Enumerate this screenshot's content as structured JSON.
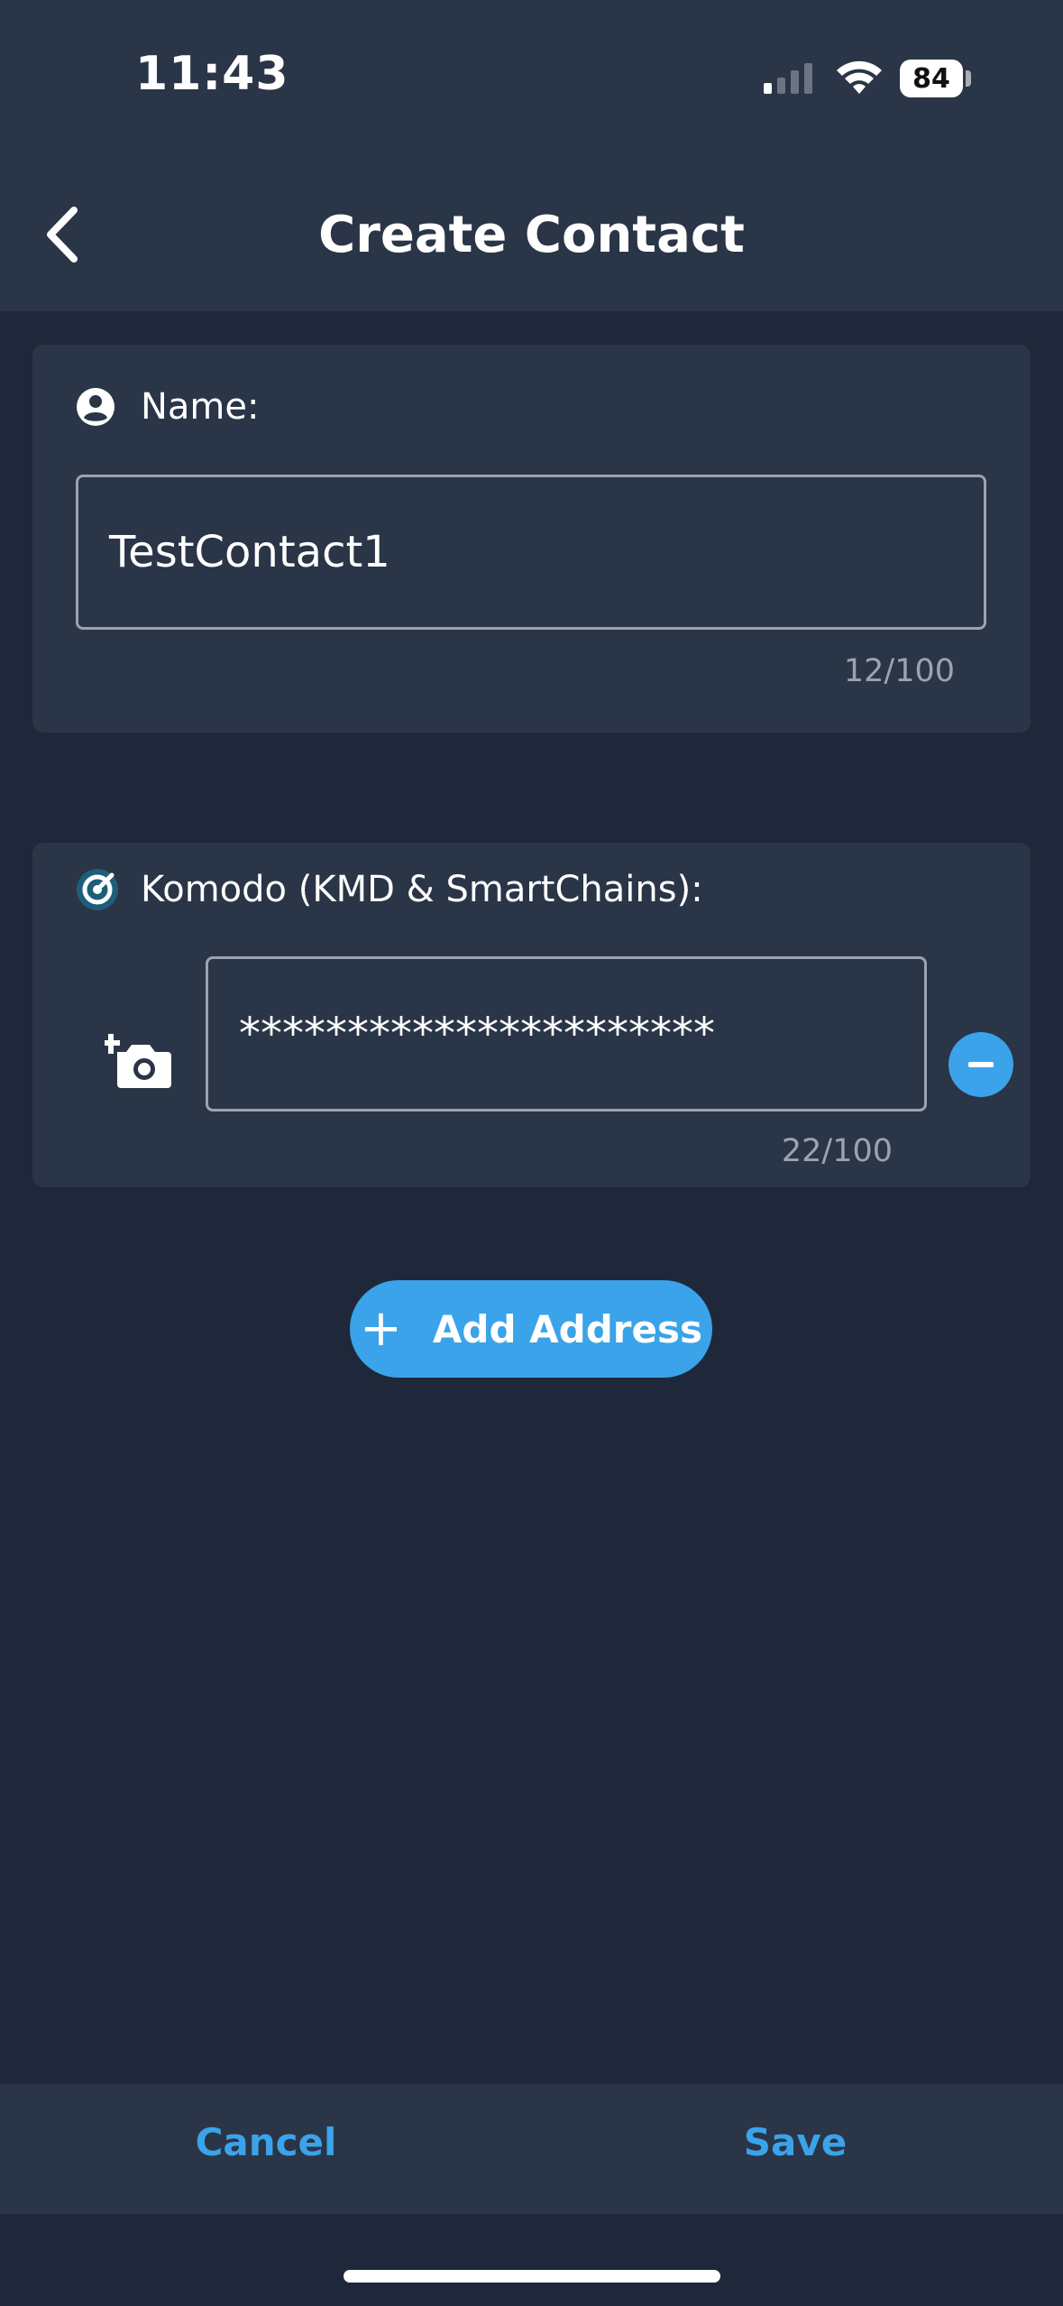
{
  "status_bar": {
    "time": "11:43",
    "battery": "84"
  },
  "header": {
    "title": "Create Contact",
    "back_icon": "chevron-left-icon"
  },
  "name_section": {
    "icon": "account-circle-icon",
    "label": "Name:",
    "value": "TestContact1",
    "counter": "12/100"
  },
  "address_section": {
    "coin_icon": "komodo-icon",
    "label": "Komodo (KMD & SmartChains):",
    "value": "**********************",
    "counter": "22/100",
    "scan_icon": "add-photo-camera-icon",
    "remove_icon": "minus-circle-icon"
  },
  "add_address": {
    "label": "Add Address",
    "icon": "plus-icon"
  },
  "footer": {
    "cancel_label": "Cancel",
    "save_label": "Save"
  },
  "colors": {
    "background": "#1f283a",
    "surface": "#2a3547",
    "accent": "#3aa3e9",
    "muted_text": "#9aa3b0"
  }
}
